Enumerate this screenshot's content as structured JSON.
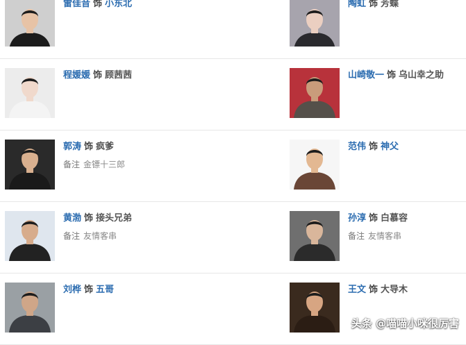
{
  "cast": [
    {
      "actor": "雷佳音",
      "sep": "饰",
      "role": "小东北",
      "role_is_link": true,
      "note_label": "",
      "note": "",
      "photo_icon": "actor-photo",
      "bg": "#cfcfcf",
      "suit": "#1c1c1c",
      "skin": "#e7c3a6"
    },
    {
      "actor": "陶虹",
      "sep": "饰",
      "role": "芳蝶",
      "role_is_link": false,
      "note_label": "",
      "note": "",
      "photo_icon": "actor-photo",
      "bg": "#a7a4ad",
      "suit": "#2a2a2e",
      "skin": "#ebcfc1"
    },
    {
      "actor": "程媛媛",
      "sep": "饰",
      "role": "顾茜茜",
      "role_is_link": false,
      "note_label": "",
      "note": "",
      "photo_icon": "actor-photo",
      "bg": "#ececec",
      "suit": "#f4f4f4",
      "skin": "#f0d9cc"
    },
    {
      "actor": "山崎敬一",
      "sep": "饰",
      "role": "乌山幸之助",
      "role_is_link": false,
      "note_label": "",
      "note": "",
      "photo_icon": "actor-photo",
      "bg": "#b8323b",
      "suit": "#55504a",
      "skin": "#c99c7b"
    },
    {
      "actor": "郭涛",
      "sep": "饰",
      "role": "疯爹",
      "role_is_link": false,
      "note_label": "备注",
      "note": "金镖十三郎",
      "photo_icon": "actor-photo",
      "bg": "#2a2a2a",
      "suit": "#1a1a1a",
      "skin": "#d9b08f"
    },
    {
      "actor": "范伟",
      "sep": "饰",
      "role": "神父",
      "role_is_link": true,
      "note_label": "",
      "note": "",
      "photo_icon": "actor-photo",
      "bg": "#f6f6f6",
      "suit": "#6a4636",
      "skin": "#e3b892"
    },
    {
      "actor": "黄渤",
      "sep": "饰",
      "role": "接头兄弟",
      "role_is_link": false,
      "note_label": "备注",
      "note": "友情客串",
      "photo_icon": "actor-photo",
      "bg": "#dfe6ee",
      "suit": "#222222",
      "skin": "#d7ac8c"
    },
    {
      "actor": "孙淳",
      "sep": "饰",
      "role": "白慕容",
      "role_is_link": false,
      "note_label": "备注",
      "note": "友情客串",
      "photo_icon": "actor-photo",
      "bg": "#6f6f6f",
      "suit": "#2b2b2b",
      "skin": "#d9b69b"
    },
    {
      "actor": "刘桦",
      "sep": "饰",
      "role": "五哥",
      "role_is_link": true,
      "note_label": "",
      "note": "",
      "photo_icon": "actor-photo",
      "bg": "#9aa0a4",
      "suit": "#3c3f44",
      "skin": "#cfa688"
    },
    {
      "actor": "王文",
      "sep": "饰",
      "role": "大导木",
      "role_is_link": false,
      "note_label": "",
      "note": "",
      "photo_icon": "actor-photo",
      "bg": "#3a2a1e",
      "suit": "#2b1d14",
      "skin": "#d7a582"
    }
  ],
  "watermark": "头条 @喵喵小咪很厉害"
}
